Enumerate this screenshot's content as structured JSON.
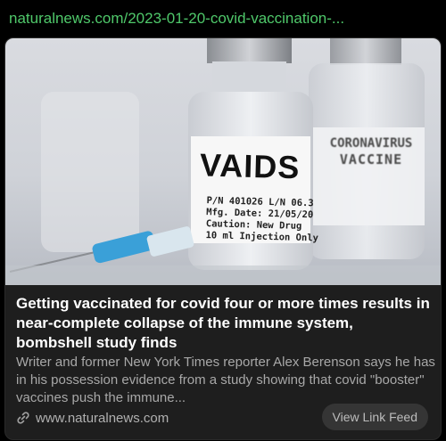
{
  "url_bar": {
    "text": "naturalnews.com/2023-01-20-covid-vaccination-..."
  },
  "card": {
    "image": {
      "vial_label": "VAIDS",
      "vial_lines": [
        "P/N 401026 L/N 06.3",
        "Mfg. Date: 21/05/20",
        "Caution: New Drug",
        "10 ml Injection Only"
      ],
      "back_label_line1": "CORONAVIRUS",
      "back_label_line2": "VACCINE"
    },
    "headline": "Getting vaccinated for covid four or more times results in near-complete collapse of the immune system, bombshell study finds",
    "description": "Writer and former New York Times reporter Alex Berenson says he has in his possession evidence from a study showing that covid \"booster\" vaccines push the immune...",
    "domain": "www.naturalnews.com",
    "link_icon": "link-icon",
    "view_feed_label": "View Link Feed"
  },
  "colors": {
    "url": "#4fc86a",
    "card_bg": "#1e1e1e",
    "button_bg": "#353535"
  }
}
